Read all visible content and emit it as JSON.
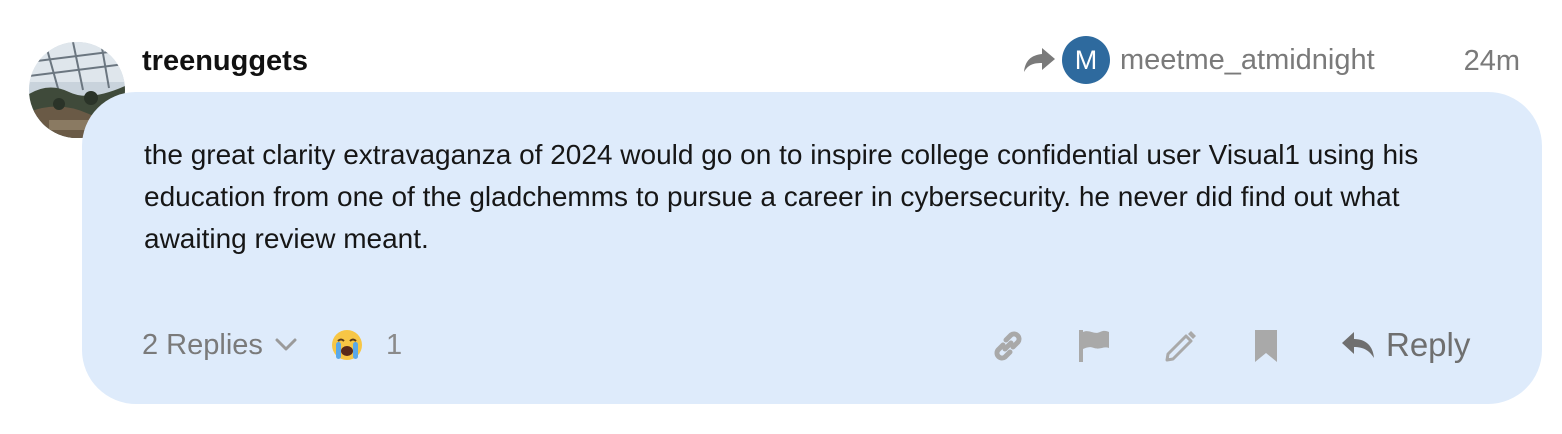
{
  "post": {
    "username": "treenuggets",
    "reply_to": {
      "avatar_letter": "M",
      "username": "meetme_atmidnight",
      "avatar_color": "#2e6a9e"
    },
    "timestamp": "24m",
    "body": "the great clarity extravaganza of 2024 would go on to inspire college confidential user Visual1 using his education from one of the gladchemms to pursue a career in cybersecurity. he never did find out what awaiting review meant."
  },
  "footer": {
    "replies_label": "2 Replies",
    "reaction_count": "1",
    "reaction_icon": "loudly-crying-face-icon",
    "reply_label": "Reply"
  },
  "colors": {
    "bubble_bg": "#deebfb",
    "muted_text": "#7a7a7a",
    "icon_gray": "#a9a9a9"
  }
}
